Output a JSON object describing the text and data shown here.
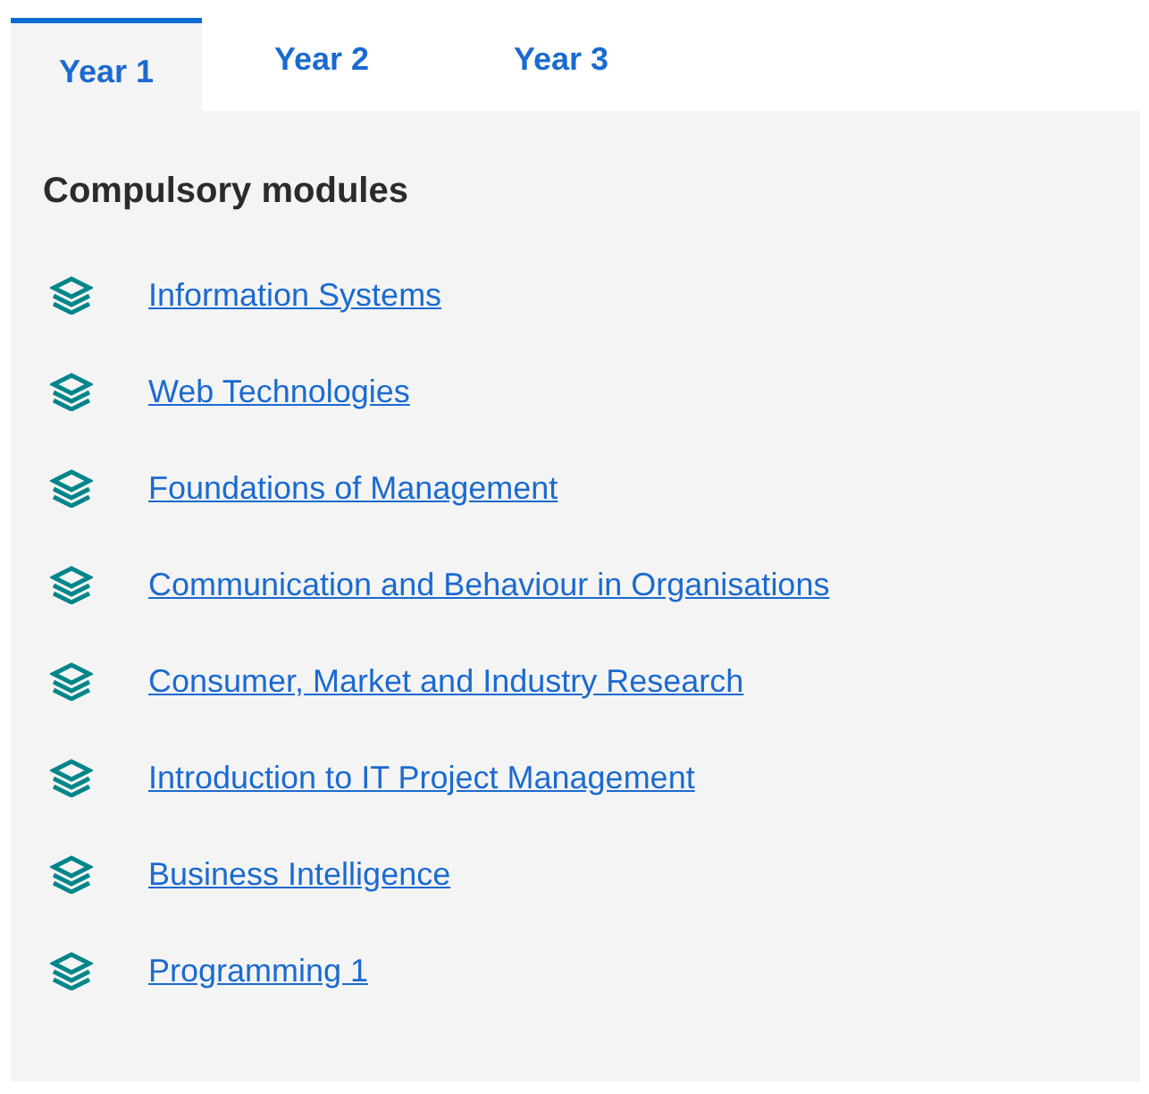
{
  "tabs": [
    {
      "label": "Year 1",
      "selected": true
    },
    {
      "label": "Year 2",
      "selected": false
    },
    {
      "label": "Year 3",
      "selected": false
    }
  ],
  "panel": {
    "heading": "Compulsory modules",
    "modules": [
      {
        "title": "Information Systems"
      },
      {
        "title": "Web Technologies"
      },
      {
        "title": "Foundations of Management"
      },
      {
        "title": "Communication and Behaviour in Organisations"
      },
      {
        "title": "Consumer, Market and Industry Research"
      },
      {
        "title": "Introduction to IT Project Management"
      },
      {
        "title": "Business Intelligence"
      },
      {
        "title": "Programming 1"
      }
    ]
  }
}
